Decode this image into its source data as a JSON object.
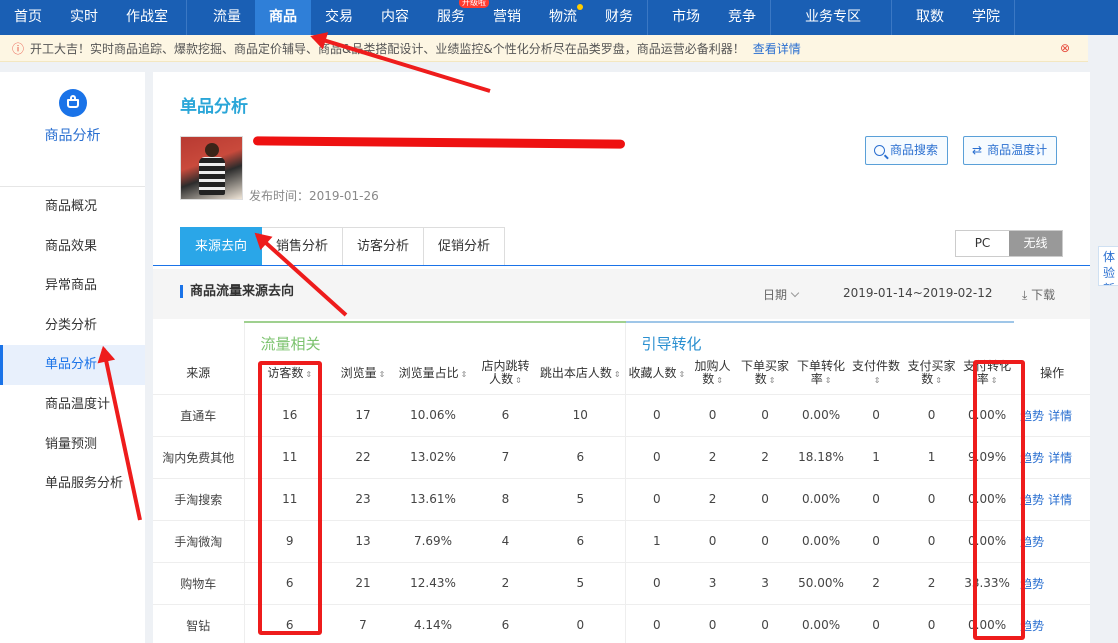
{
  "topnav": {
    "groups": [
      [
        {
          "label": "首页"
        },
        {
          "label": "实时"
        },
        {
          "label": "作战室"
        }
      ],
      [
        {
          "label": "流量"
        },
        {
          "label": "商品",
          "active": true
        },
        {
          "label": "交易"
        },
        {
          "label": "内容"
        },
        {
          "label": "服务",
          "badge": "升级啦"
        },
        {
          "label": "营销"
        },
        {
          "label": "物流",
          "dot": true
        },
        {
          "label": "财务"
        }
      ],
      [
        {
          "label": "市场"
        },
        {
          "label": "竞争"
        }
      ],
      [
        {
          "label": "业务专区"
        }
      ],
      [
        {
          "label": "取数"
        },
        {
          "label": "学院"
        }
      ]
    ]
  },
  "notice": {
    "text": "开工大吉！实时商品追踪、爆款挖掘、商品定价辅导、商品&品类搭配设计、业绩监控&个性化分析尽在品类罗盘，商品运营必备利器！",
    "link": "查看详情"
  },
  "sidebar": {
    "title": "商品分析",
    "items": [
      {
        "label": "商品概况"
      },
      {
        "label": "商品效果"
      },
      {
        "label": "异常商品"
      },
      {
        "label": "分类分析"
      },
      {
        "label": "单品分析",
        "active": true
      },
      {
        "label": "商品温度计"
      },
      {
        "label": "销量预测"
      },
      {
        "label": "单品服务分析"
      }
    ]
  },
  "main": {
    "title": "单品分析",
    "publish_time": "发布时间：2019-01-26",
    "search_button": "商品搜索",
    "thermo_button": "商品温度计",
    "tabs": [
      {
        "label": "来源去向",
        "active": true
      },
      {
        "label": "销售分析"
      },
      {
        "label": "访客分析"
      },
      {
        "label": "促销分析"
      }
    ],
    "devices": [
      {
        "label": "PC"
      },
      {
        "label": "无线",
        "active": true
      }
    ],
    "section_title": "商品流量来源去向",
    "date_label": "日期",
    "date_range": "2019-01-14~2019-02-12",
    "download": "下载"
  },
  "table": {
    "group_traffic": "流量相关",
    "group_convert": "引导转化",
    "source_header": "来源",
    "op_header": "操作",
    "headers": [
      "访客数",
      "浏览量",
      "浏览量占比",
      "店内跳转人数",
      "跳出本店人数",
      "收藏人数",
      "加购人数",
      "下单买家数",
      "下单转化率",
      "支付件数",
      "支付买家数",
      "支付转化率"
    ],
    "rows": [
      {
        "source": "直通车",
        "values": [
          "16",
          "17",
          "10.06%",
          "6",
          "10",
          "0",
          "0",
          "0",
          "0.00%",
          "0",
          "0",
          "0.00%"
        ],
        "ops": [
          "趋势",
          "详情"
        ]
      },
      {
        "source": "淘内免费其他",
        "values": [
          "11",
          "22",
          "13.02%",
          "7",
          "6",
          "0",
          "2",
          "2",
          "18.18%",
          "1",
          "1",
          "9.09%"
        ],
        "ops": [
          "趋势",
          "详情"
        ]
      },
      {
        "source": "手淘搜索",
        "values": [
          "11",
          "23",
          "13.61%",
          "8",
          "5",
          "0",
          "2",
          "0",
          "0.00%",
          "0",
          "0",
          "0.00%"
        ],
        "ops": [
          "趋势",
          "详情"
        ]
      },
      {
        "source": "手淘微淘",
        "values": [
          "9",
          "13",
          "7.69%",
          "4",
          "6",
          "1",
          "0",
          "0",
          "0.00%",
          "0",
          "0",
          "0.00%"
        ],
        "ops": [
          "趋势"
        ]
      },
      {
        "source": "购物车",
        "values": [
          "6",
          "21",
          "12.43%",
          "2",
          "5",
          "0",
          "3",
          "3",
          "50.00%",
          "2",
          "2",
          "33.33%"
        ],
        "ops": [
          "趋势"
        ]
      },
      {
        "source": "智钻",
        "values": [
          "6",
          "7",
          "4.14%",
          "6",
          "0",
          "0",
          "0",
          "0",
          "0.00%",
          "0",
          "0",
          "0.00%"
        ],
        "ops": [
          "趋势"
        ]
      }
    ]
  },
  "edge_tab": "体验新版",
  "colors": {
    "nav": "#1a5fb4",
    "accent": "#1a73e8",
    "annotation": "#ee1c1c",
    "traffic": "#7cc36f",
    "convert": "#2a8fd0"
  }
}
